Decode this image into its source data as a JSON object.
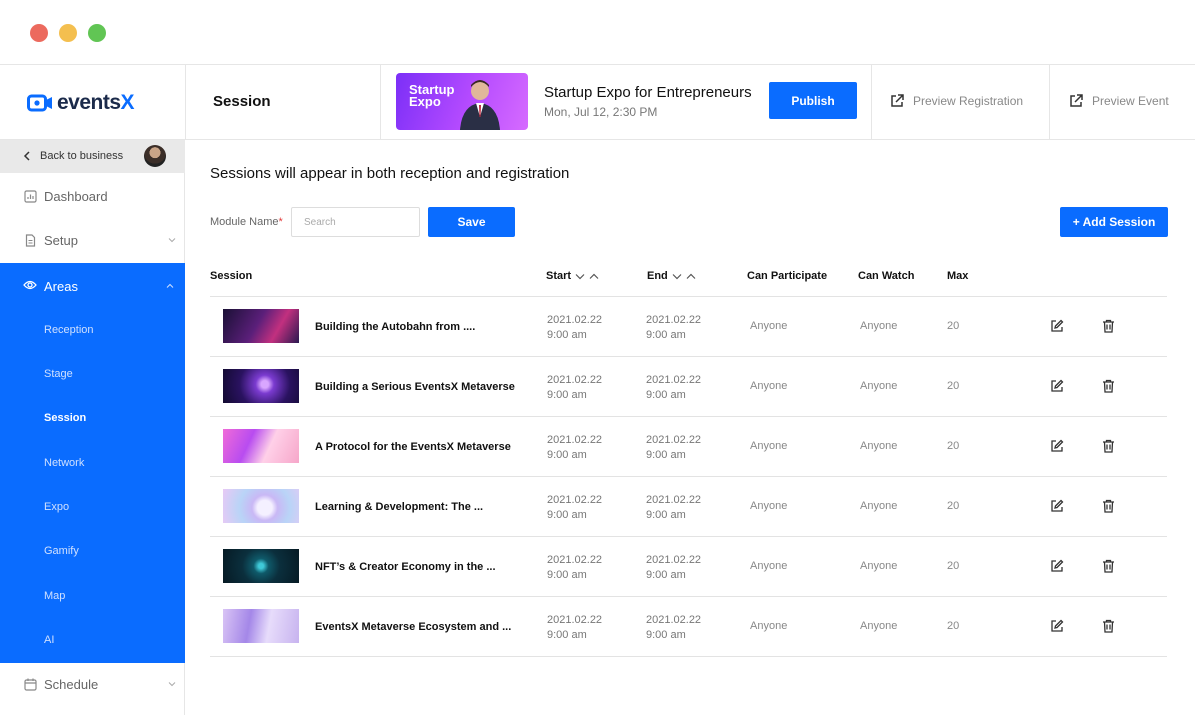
{
  "header": {
    "logo_text_main": "events",
    "logo_text_accent": "X",
    "page_title": "Session",
    "event_thumb_text": "Startup Expo",
    "event_name": "Startup Expo for Entrepreneurs",
    "event_date": "Mon, Jul 12, 2:30 PM",
    "publish_label": "Publish",
    "preview_registration_label": "Preview Registration",
    "preview_event_label": "Preview Event"
  },
  "sidebar": {
    "back_label": "Back to business",
    "dashboard_label": "Dashboard",
    "setup_label": "Setup",
    "areas_label": "Areas",
    "areas_items": [
      "Reception",
      "Stage",
      "Session",
      "Network",
      "Expo",
      "Gamify",
      "Map",
      "AI"
    ],
    "active_item": "Session",
    "schedule_label": "Schedule"
  },
  "main": {
    "section_title": "Sessions will appear in both reception and registration",
    "module_label": "Module Name",
    "module_required_mark": "*",
    "search_placeholder": "Search",
    "save_label": "Save",
    "add_session_label": "+ Add Session",
    "columns": {
      "session": "Session",
      "start": "Start",
      "end": "End",
      "can_participate": "Can Participate",
      "can_watch": "Can Watch",
      "max": "Max"
    },
    "rows": [
      {
        "name": "Building the Autobahn from ....",
        "start_date": "2021.02.22",
        "start_time": "9:00 am",
        "end_date": "2021.02.22",
        "end_time": "9:00 am",
        "can_participate": "Anyone",
        "can_watch": "Anyone",
        "max": "20"
      },
      {
        "name": "Building a Serious EventsX Metaverse",
        "start_date": "2021.02.22",
        "start_time": "9:00 am",
        "end_date": "2021.02.22",
        "end_time": "9:00 am",
        "can_participate": "Anyone",
        "can_watch": "Anyone",
        "max": "20"
      },
      {
        "name": "A Protocol for the EventsX Metaverse",
        "start_date": "2021.02.22",
        "start_time": "9:00 am",
        "end_date": "2021.02.22",
        "end_time": "9:00 am",
        "can_participate": "Anyone",
        "can_watch": "Anyone",
        "max": "20"
      },
      {
        "name": "Learning & Development: The ...",
        "start_date": "2021.02.22",
        "start_time": "9:00 am",
        "end_date": "2021.02.22",
        "end_time": "9:00 am",
        "can_participate": "Anyone",
        "can_watch": "Anyone",
        "max": "20"
      },
      {
        "name": "NFT’s & Creator Economy in the ...",
        "start_date": "2021.02.22",
        "start_time": "9:00 am",
        "end_date": "2021.02.22",
        "end_time": "9:00 am",
        "can_participate": "Anyone",
        "can_watch": "Anyone",
        "max": "20"
      },
      {
        "name": "EventsX Metaverse Ecosystem and ...",
        "start_date": "2021.02.22",
        "start_time": "9:00 am",
        "end_date": "2021.02.22",
        "end_time": "9:00 am",
        "can_participate": "Anyone",
        "can_watch": "Anyone",
        "max": "20"
      }
    ]
  },
  "colors": {
    "accent": "#0a6cff",
    "sidebar_active_bg": "#0a6cff",
    "required": "#e23b3b"
  }
}
